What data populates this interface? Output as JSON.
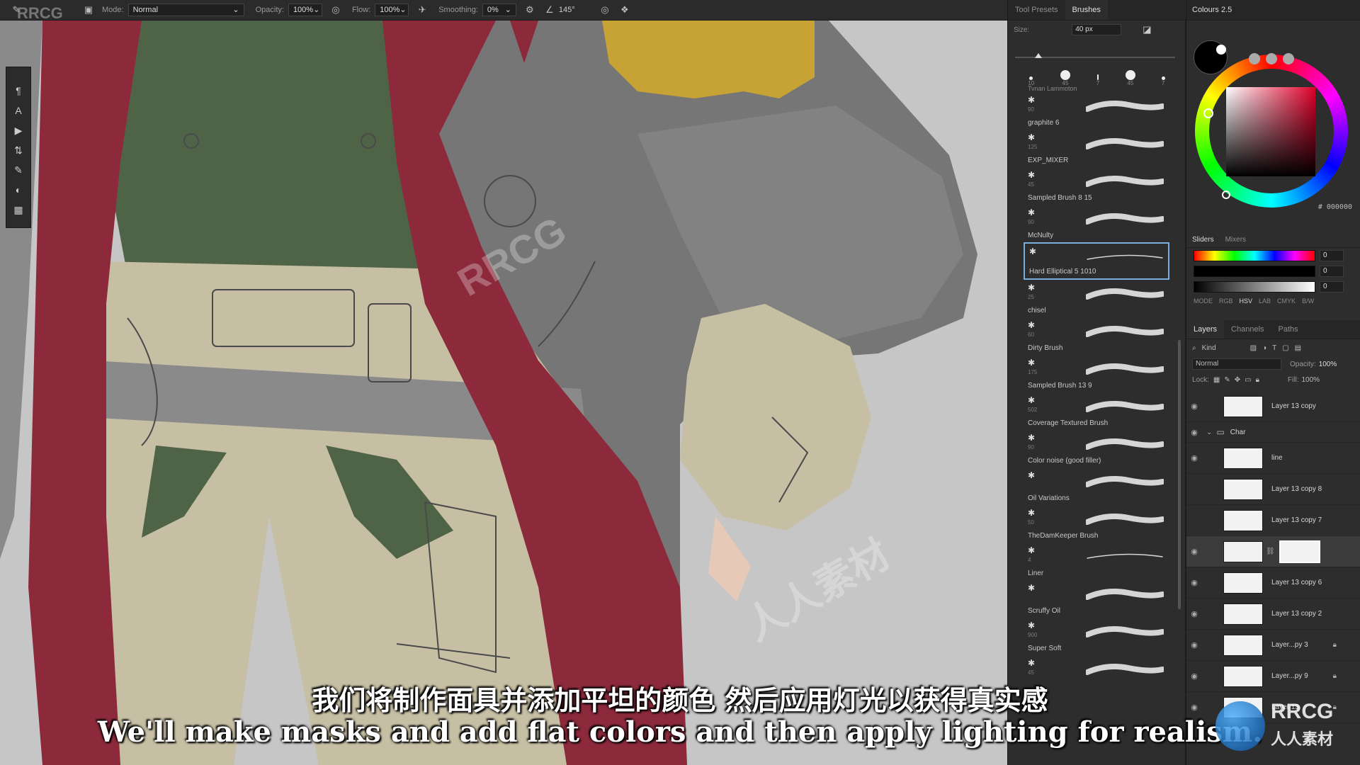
{
  "watermark_top": "RRCG",
  "toolbar": {
    "mode_label": "Mode:",
    "mode_value": "Normal",
    "opacity_label": "Opacity:",
    "opacity_value": "100%",
    "flow_label": "Flow:",
    "flow_value": "100%",
    "smoothing_label": "Smoothing:",
    "smoothing_value": "0%",
    "angle_value": "145°"
  },
  "brushes_panel": {
    "tabs": [
      "Tool Presets",
      "Brushes"
    ],
    "size_label": "Size:",
    "size_value": "40 px",
    "presets": [
      "10",
      "45",
      "7",
      "45",
      "7"
    ],
    "cut_label": "Tynan Lammoton",
    "brushes": [
      {
        "name": "graphite 6",
        "num": "90"
      },
      {
        "name": "EXP_MIXER",
        "num": "125"
      },
      {
        "name": "Sampled Brush 8 15",
        "num": "45"
      },
      {
        "name": "McNulty",
        "num": "90"
      },
      {
        "name": "Hard Elliptical 5 1010",
        "num": ""
      },
      {
        "name": "chisel",
        "num": "25"
      },
      {
        "name": "Dirty Brush",
        "num": "60"
      },
      {
        "name": "Sampled Brush 13 9",
        "num": "175"
      },
      {
        "name": "Coverage Textured Brush",
        "num": "502"
      },
      {
        "name": "Color noise (good filler)",
        "num": "90"
      },
      {
        "name": "Oil Variations",
        "num": ""
      },
      {
        "name": "TheDamKeeper Brush",
        "num": "50"
      },
      {
        "name": "Liner",
        "num": "4"
      },
      {
        "name": "Scruffy Oil",
        "num": ""
      },
      {
        "name": "Super Soft",
        "num": "900"
      },
      {
        "name": "",
        "num": "45"
      }
    ]
  },
  "colours": {
    "title": "Colours 2.5",
    "hex": "# 000000",
    "sub_tabs": [
      "Sliders",
      "Mixers"
    ],
    "slider_values": [
      "0",
      "0",
      "0"
    ],
    "modes": [
      "MODE",
      "RGB",
      "HSV",
      "LAB",
      "CMYK",
      "B/W"
    ]
  },
  "layers": {
    "tabs": [
      "Layers",
      "Channels",
      "Paths"
    ],
    "kind_label": "Kind",
    "blend_mode": "Normal",
    "opacity_label": "Opacity:",
    "opacity_value": "100%",
    "lock_label": "Lock:",
    "fill_label": "Fill:",
    "fill_value": "100%",
    "items": [
      {
        "name": "Layer 13 copy",
        "visible": true,
        "locked": false
      },
      {
        "name": "Char",
        "visible": true,
        "group": true
      },
      {
        "name": "line",
        "visible": true,
        "locked": false
      },
      {
        "name": "Layer 13 copy 8",
        "visible": false,
        "locked": false
      },
      {
        "name": "Layer 13 copy 7",
        "visible": false,
        "locked": false
      },
      {
        "name": "",
        "visible": true,
        "selected": true,
        "mask": true
      },
      {
        "name": "Layer 13 copy 6",
        "visible": true,
        "locked": false
      },
      {
        "name": "Layer 13 copy 2",
        "visible": true,
        "locked": false
      },
      {
        "name": "Layer...py 3",
        "visible": true,
        "locked": true
      },
      {
        "name": "Layer...py 9",
        "visible": true,
        "locked": true
      },
      {
        "name": "Layer 13",
        "visible": true,
        "locked": true
      }
    ]
  },
  "subtitles": {
    "cn": "我们将制作面具并添加平坦的颜色 然后应用灯光以获得真实感",
    "en": "We'll make masks and add flat colors and then apply lighting for realism."
  },
  "logo": {
    "name": "RRCG",
    "sub": "人人素材"
  },
  "colors": {
    "red_cape": "#8c2a3c",
    "green_vest": "#4f6446",
    "beige_pants": "#c7bfa4",
    "gray_coat": "#7a7a7a",
    "gold": "#c7a234",
    "canvas_bg": "#c6c6c6",
    "panel_bg": "#2d2d2d",
    "accent": "#7aaedc"
  }
}
